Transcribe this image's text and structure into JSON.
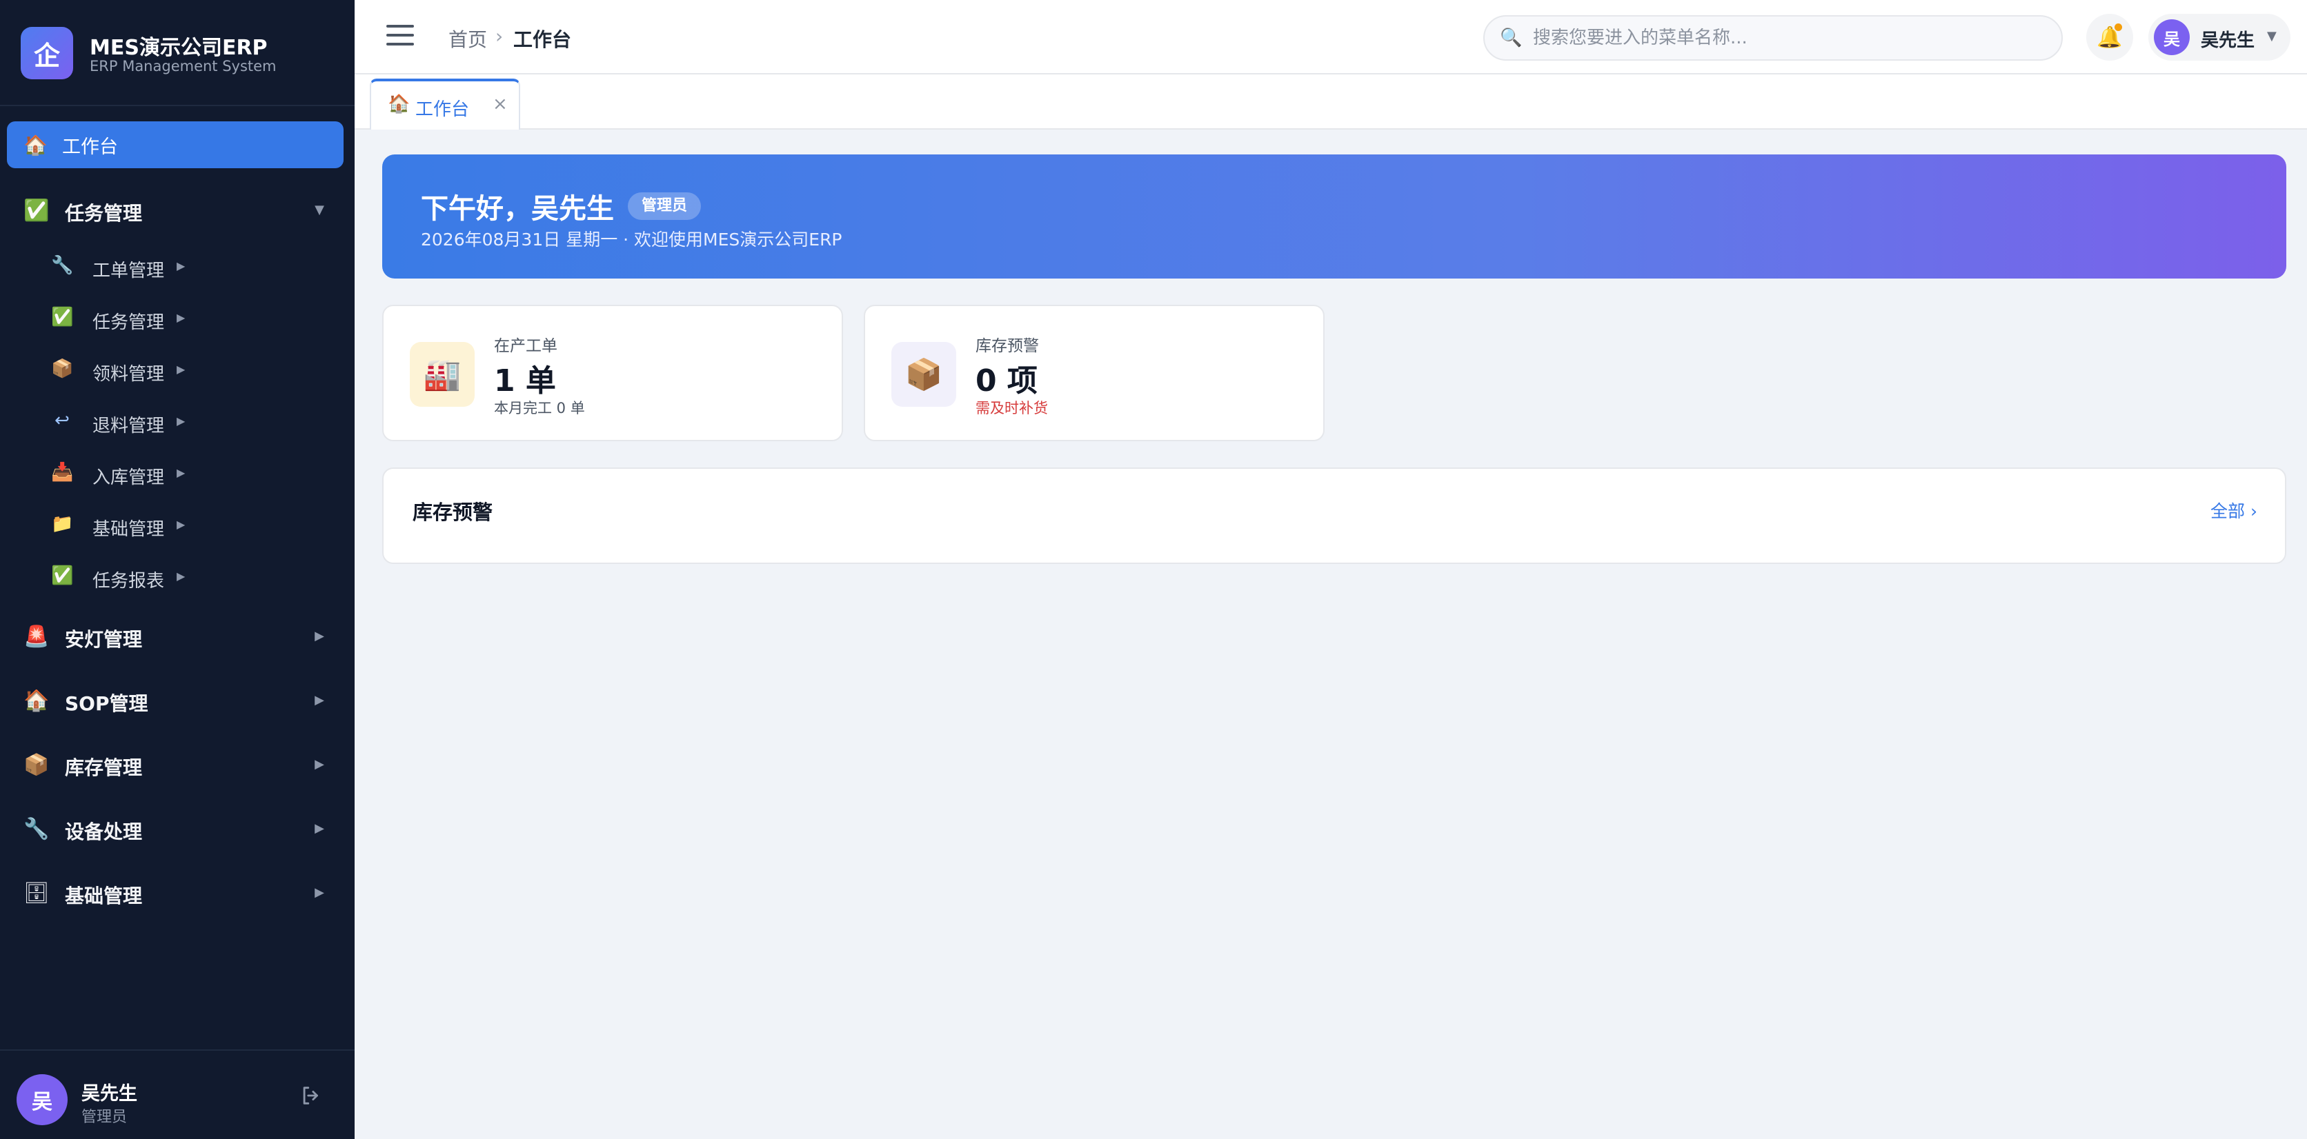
{
  "brand": {
    "logo_text": "企",
    "name": "MES演示公司ERP",
    "subtitle": "ERP Management System"
  },
  "sidebar": {
    "active_item": {
      "icon": "🏠",
      "label": "工作台"
    },
    "task_group": {
      "icon": "✅",
      "label": "任务管理",
      "arrow": "▼",
      "children": [
        {
          "icon": "🔧",
          "label": "工单管理",
          "arrow": "▶"
        },
        {
          "icon": "✅",
          "label": "任务管理",
          "arrow": "▶"
        },
        {
          "icon": "📦",
          "label": "领料管理",
          "arrow": "▶"
        },
        {
          "icon": "↩",
          "label": "退料管理",
          "arrow": "▶"
        },
        {
          "icon": "📥",
          "label": "入库管理",
          "arrow": "▶"
        },
        {
          "icon": "📁",
          "label": "基础管理",
          "arrow": "▶"
        },
        {
          "icon": "✅",
          "label": "任务报表",
          "arrow": "▶"
        }
      ]
    },
    "groups": [
      {
        "icon": "🚨",
        "label": "安灯管理",
        "arrow": "▶"
      },
      {
        "icon": "🏠",
        "label": "SOP管理",
        "arrow": "▶"
      },
      {
        "icon": "📦",
        "label": "库存管理",
        "arrow": "▶"
      },
      {
        "icon": "🔧",
        "label": "设备处理",
        "arrow": "▶"
      },
      {
        "icon": "🗄",
        "label": "基础管理",
        "arrow": "▶"
      }
    ],
    "footer": {
      "avatar": "吴",
      "name": "吴先生",
      "role": "管理员"
    }
  },
  "topbar": {
    "breadcrumb": {
      "home": "首页",
      "separator": "›",
      "current": "工作台"
    },
    "search": {
      "placeholder": "搜索您要进入的菜单名称...",
      "icon": "🔍"
    },
    "bell_icon": "🔔",
    "user": {
      "avatar": "吴",
      "name": "吴先生",
      "dropdown": "▼"
    }
  },
  "tabs": [
    {
      "icon": "🏠",
      "label": "工作台",
      "close": "×"
    }
  ],
  "banner": {
    "greeting": "下午好，吴先生",
    "role_badge": "管理员",
    "subtitle": "2026年08月31日 星期一 · 欢迎使用MES演示公司ERP"
  },
  "stats": [
    {
      "icon": "🏭",
      "label": "在产工单",
      "value": "1 单",
      "sub": "本月完工 0 单"
    },
    {
      "icon": "📦",
      "label": "库存预警",
      "value": "0 项",
      "sub": "需及时补货"
    }
  ],
  "panel": {
    "title": "库存预警",
    "link": "全部 ›"
  },
  "colors": {
    "accent": "#3678e6",
    "sidebar_bg": "#111a2e",
    "warning": "#d63c3c"
  }
}
